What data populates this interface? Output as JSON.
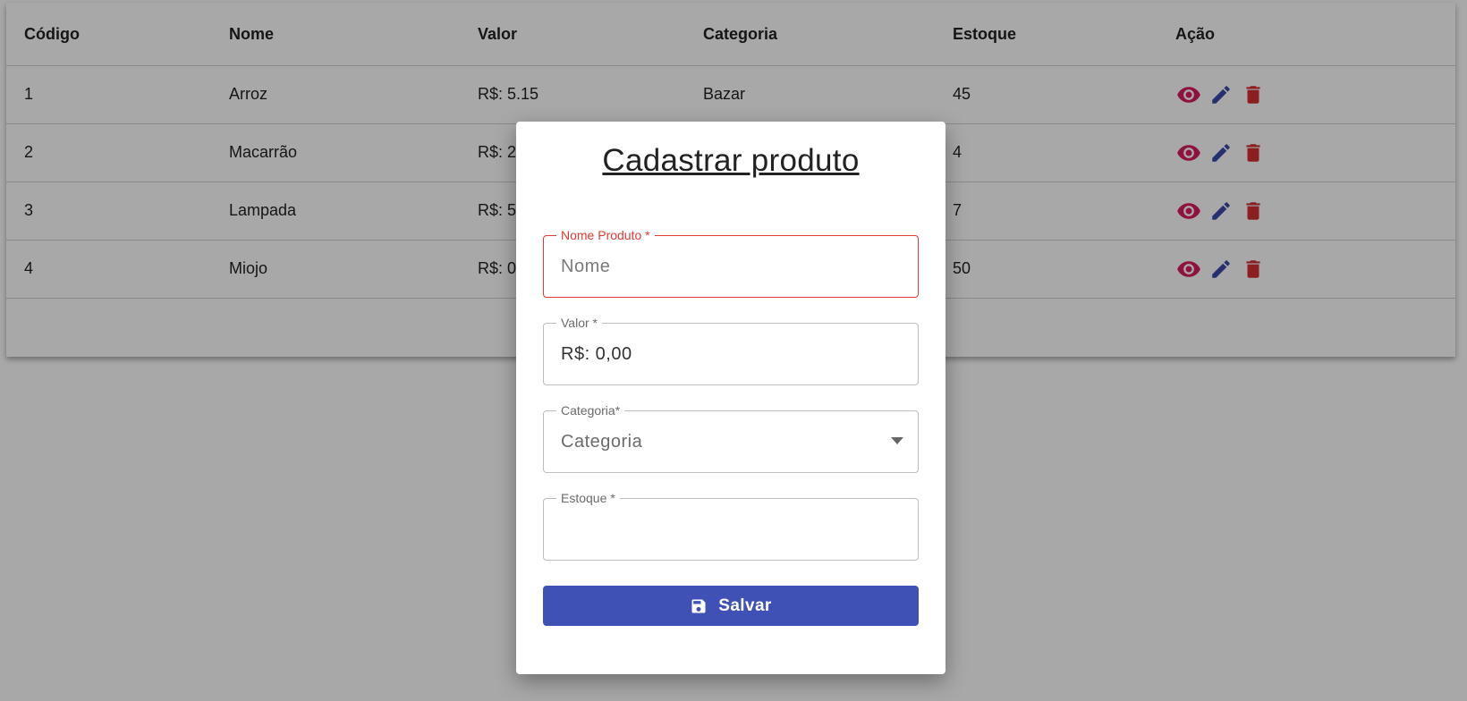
{
  "table": {
    "headers": [
      "Código",
      "Nome",
      "Valor",
      "Categoria",
      "Estoque",
      "Ação"
    ],
    "rows": [
      {
        "codigo": "1",
        "nome": "Arroz",
        "valor": "R$: 5.15",
        "categoria": "Bazar",
        "estoque": "45"
      },
      {
        "codigo": "2",
        "nome": "Macarrão",
        "valor": "R$: 2",
        "categoria": "",
        "estoque": "4"
      },
      {
        "codigo": "3",
        "nome": "Lampada",
        "valor": "R$: 5",
        "categoria": "",
        "estoque": "7"
      },
      {
        "codigo": "4",
        "nome": "Miojo",
        "valor": "R$: 0",
        "categoria": "",
        "estoque": "50"
      }
    ],
    "action_icons": [
      "eye-icon",
      "pencil-icon",
      "trash-icon"
    ]
  },
  "modal": {
    "title": "Cadastrar produto",
    "fields": {
      "nome": {
        "label": "Nome Produto *",
        "placeholder": "Nome",
        "value": ""
      },
      "valor": {
        "label": "Valor *",
        "value": "R$: 0,00"
      },
      "categoria": {
        "label": "Categoria*",
        "selected": "Categoria"
      },
      "estoque": {
        "label": "Estoque *",
        "value": ""
      }
    },
    "save_label": "Salvar"
  },
  "colors": {
    "primary": "#3f51b5",
    "error": "#e53935",
    "view_icon": "#d81b60",
    "edit_icon": "#3949ab",
    "delete_icon": "#d32f2f"
  }
}
